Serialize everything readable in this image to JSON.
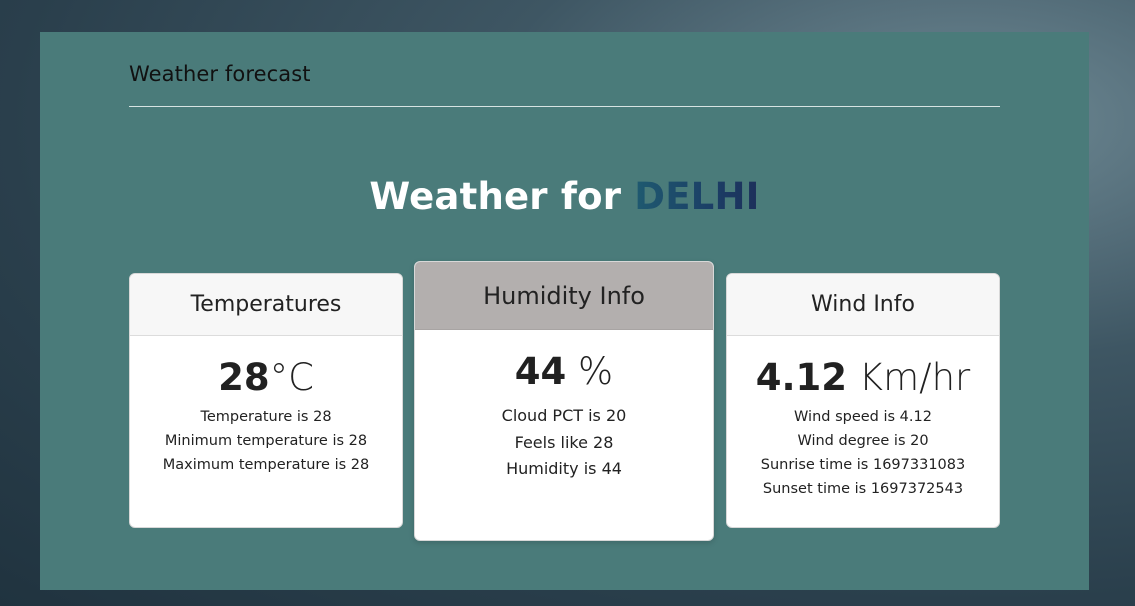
{
  "app": {
    "title": "Weather forecast"
  },
  "heading": {
    "prefix": "Weather for ",
    "city": "DELHI"
  },
  "cards": {
    "temperature": {
      "title": "Temperatures",
      "value": "28",
      "unit": "°C",
      "lines": [
        "Temperature is 28",
        "Minimum temperature is 28",
        "Maximum temperature is 28"
      ]
    },
    "humidity": {
      "title": "Humidity Info",
      "value": "44",
      "unit": " %",
      "lines": [
        "Cloud PCT is 20",
        "Feels like 28",
        "Humidity is 44"
      ]
    },
    "wind": {
      "title": "Wind Info",
      "value": "4.12",
      "unit": " Km/hr",
      "lines": [
        "Wind speed is 4.12",
        "Wind degree is 20",
        "Sunrise time is 1697331083",
        "Sunset time is 1697372543"
      ]
    }
  },
  "colors": {
    "panel": "#4a7b7a",
    "featured_header": "#b3afae",
    "city_text": "#1b3f66"
  }
}
